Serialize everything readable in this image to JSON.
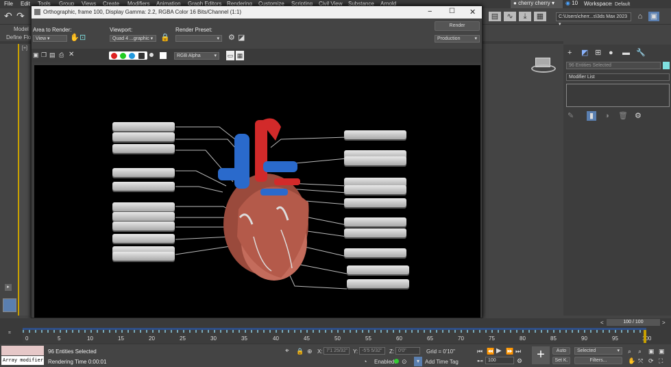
{
  "menu": [
    "File",
    "Edit",
    "Tools",
    "Group",
    "Views",
    "Create",
    "Modifiers",
    "Animation",
    "Graph Editors",
    "Rendering",
    "Customize",
    "Scripting",
    "Civil View",
    "Substance",
    "Arnold"
  ],
  "user": "cherry cherry",
  "notifications": "10",
  "workspaces_label": "Workspaces:",
  "workspace": "Default",
  "project_path": "C:\\Users\\cherr...s\\3ds Max 2023",
  "ribbon_tabs": [
    "Model",
    "Define Flo"
  ],
  "viewport_label": "[+]",
  "render_frame": {
    "title": "Orthographic, frame 100, Display Gamma: 2.2, RGBA Color 16 Bits/Channel (1:1)",
    "area_label": "Area to Render:",
    "area_value": "View",
    "viewport_label": "Viewport:",
    "viewport_value": "Quad 4 ...graphic",
    "preset_label": "Render Preset:",
    "preset_value": "",
    "render_button": "Render",
    "production": "Production",
    "channel": "RGB Alpha"
  },
  "command_panel": {
    "selection": "96 Entities Selected",
    "modifier_list": "Modifier List"
  },
  "timeslider": {
    "position": "100 / 100",
    "ticks": [
      "0",
      "5",
      "10",
      "15",
      "20",
      "25",
      "30",
      "35",
      "40",
      "45",
      "50",
      "55",
      "60",
      "65",
      "70",
      "75",
      "80",
      "85",
      "90",
      "95",
      "100"
    ]
  },
  "status": {
    "script": "Array modifier",
    "selected": "96 Entities Selected",
    "render_time": "Rendering Time  0:00:01",
    "x_label": "X:",
    "x": "7'1 25/32\"",
    "y_label": "Y:",
    "y": "-5'5 5/32\"",
    "z_label": "Z:",
    "z": "0'0\"",
    "grid": "Grid = 0'10\"",
    "enabled": "Enabled:",
    "add_time_tag": "Add Time Tag",
    "frame": "100",
    "auto": "Auto",
    "setk": "Set K.",
    "selected_dd": "Selected",
    "filters": "Filters..."
  }
}
